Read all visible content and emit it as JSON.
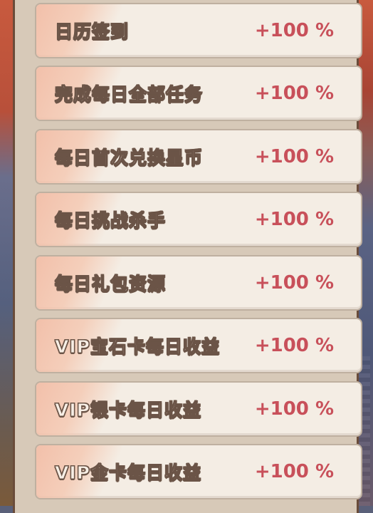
{
  "rewards": [
    {
      "label": "日历签到",
      "bonus": "+100 %"
    },
    {
      "label": "完成每日全部任务",
      "bonus": "+100 %"
    },
    {
      "label": "每日首次兑换星币",
      "bonus": "+100 %"
    },
    {
      "label": "每日挑战杀手",
      "bonus": "+100 %"
    },
    {
      "label": "每日礼包资源",
      "bonus": "+100 %"
    },
    {
      "label": "VIP宝石卡每日收益",
      "bonus": "+100 %"
    },
    {
      "label": "VIP银卡每日收益",
      "bonus": "+100 %"
    },
    {
      "label": "VIP金卡每日收益",
      "bonus": "+100 %"
    }
  ],
  "colors": {
    "bonus": "#c8505a",
    "row_bg": "#f4ede4",
    "label_outline": "#6b5447"
  }
}
